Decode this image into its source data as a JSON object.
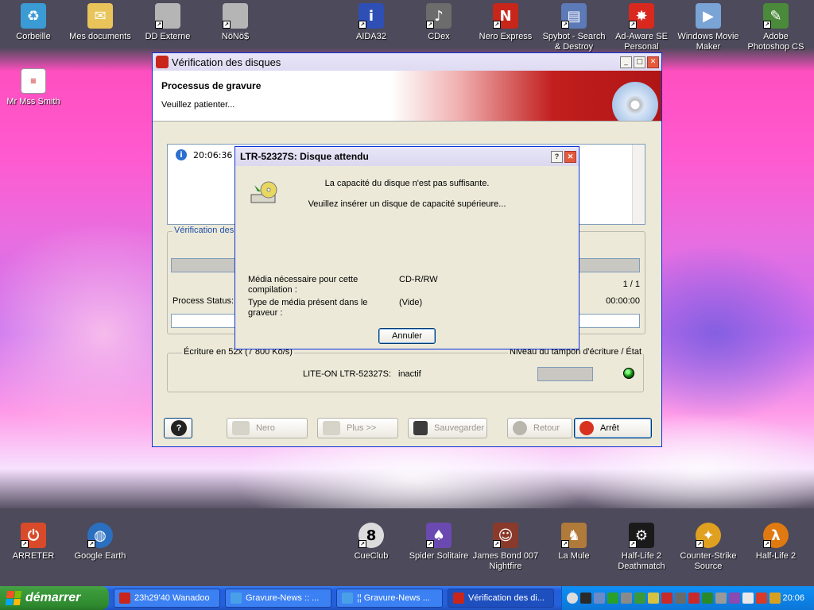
{
  "desktop": {
    "top_icons": [
      {
        "label": "Corbeille",
        "icon": "recycle-bin-icon",
        "color": "#3a9bd5"
      },
      {
        "label": "Mes documents",
        "icon": "documents-folder-icon",
        "color": "#e8c45a"
      },
      {
        "label": "DD Externe",
        "icon": "hard-drive-icon",
        "color": "#b5b5b5"
      },
      {
        "label": "NöNö$",
        "icon": "hard-drive-icon",
        "color": "#b5b5b5"
      },
      {
        "label": "AIDA32",
        "icon": "aida-icon",
        "color": "#2e4fb6"
      },
      {
        "label": "CDex",
        "icon": "cdex-icon",
        "color": "#6c6c6c"
      },
      {
        "label": "Nero Express",
        "icon": "nero-icon",
        "color": "#c8261a"
      },
      {
        "label": "Spybot - Search & Destroy",
        "icon": "spybot-icon",
        "color": "#5d7ab8"
      },
      {
        "label": "Ad-Aware SE Personal",
        "icon": "adaware-icon",
        "color": "#d9281e"
      },
      {
        "label": "Windows Movie Maker",
        "icon": "movie-maker-icon",
        "color": "#7aa3d6"
      },
      {
        "label": "Adobe Photoshop CS",
        "icon": "photoshop-icon",
        "color": "#4a8a3a"
      }
    ],
    "side_icon": {
      "label": "Mr Mss Smith",
      "icon": "document-icon"
    },
    "bottom_icons": [
      {
        "label": "ARRETER",
        "icon": "power-icon",
        "color": "#d84a2a"
      },
      {
        "label": "Google Earth",
        "icon": "google-earth-icon",
        "color": "#2a6fc0"
      },
      {
        "label": "CueClub",
        "icon": "cueclub-icon",
        "color": "#dcdcdc"
      },
      {
        "label": "Spider Solitaire",
        "icon": "spider-solitaire-icon",
        "color": "#6a4ab0"
      },
      {
        "label": "James Bond 007 Nightfire",
        "icon": "james-bond-icon",
        "color": "#8a3a2a"
      },
      {
        "label": "La Mule",
        "icon": "emule-icon",
        "color": "#b07a3a"
      },
      {
        "label": "Half-Life 2 Deathmatch",
        "icon": "steam-icon",
        "color": "#1a1a1a"
      },
      {
        "label": "Counter-Strike Source",
        "icon": "counter-strike-icon",
        "color": "#e0a020"
      },
      {
        "label": "Half-Life 2",
        "icon": "half-life-icon",
        "color": "#e07a10"
      }
    ]
  },
  "window": {
    "title": "Vérification des disques",
    "banner_title": "Processus de gravure",
    "banner_subtitle": "Veuillez patienter...",
    "log_time": "20:06:36",
    "group1_label": "Vérification des d",
    "count": "1 / 1",
    "process_label": "Process Status:",
    "elapsed": "00:00:00",
    "writer_group_label": "Écriture en 52x (7 800 Ko/s)",
    "buffer_label": "Niveau du tampon d'écriture / État",
    "drive_name": "LITE-ON LTR-52327S:",
    "drive_status": "inactif",
    "buttons": {
      "help": "?",
      "nero": "Nero",
      "more": "Plus >>",
      "save": "Sauvegarder",
      "back": "Retour",
      "stop": "Arrêt"
    }
  },
  "dialog": {
    "title": "LTR-52327S: Disque attendu",
    "line1": "La capacité du disque n'est pas suffisante.",
    "line2": "Veuillez insérer un disque de capacité supérieure...",
    "media_needed_label": "Média nécessaire pour cette compilation :",
    "media_needed_value": "CD-R/RW",
    "media_present_label": "Type de média présent dans le graveur :",
    "media_present_value": "(Vide)",
    "cancel_button": "Annuler"
  },
  "taskbar": {
    "start_label": "démarrer",
    "tasks": [
      {
        "label": "23h29'40 Wanadoo",
        "icon": "wanadoo-icon"
      },
      {
        "label": "Gravure-News :: ...",
        "icon": "ie-icon"
      },
      {
        "label": "¦¦ Gravure-News ...",
        "icon": "ie-icon"
      },
      {
        "label": "Vérification des di...",
        "icon": "nero-icon"
      }
    ],
    "clock": "20:06"
  }
}
